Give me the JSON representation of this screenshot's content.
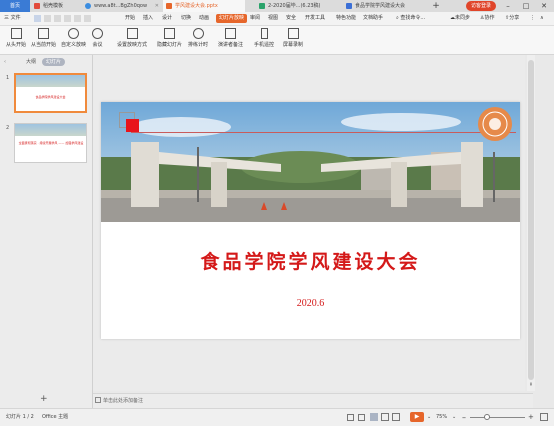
{
  "tabs": [
    {
      "label": "首页"
    },
    {
      "label": "稻壳模板"
    },
    {
      "label": "www.a8t...BgZh0qow"
    },
    {
      "label": "学风建设大会.pptx"
    },
    {
      "label": "2-2020届毕...(6.23稿)"
    },
    {
      "label": "食品学院学风建设大会"
    }
  ],
  "login_label": "访客登录",
  "menu": {
    "file": "三 文件",
    "items": [
      "开始",
      "插入",
      "设计",
      "切换",
      "动画",
      "幻灯片放映",
      "审阅",
      "视图",
      "安全",
      "开发工具",
      "特色功能",
      "文档助手"
    ],
    "search": "查找命令...",
    "unsynced": "未同步",
    "collab": "协作",
    "share": "分享"
  },
  "ribbon": {
    "buttons": [
      "从头开始",
      "从当前开始",
      "自定义放映",
      "会议",
      "设置放映方式",
      "隐藏幻灯片",
      "排练计时",
      "演讲者备注",
      "手机遥控",
      "屏幕录制"
    ]
  },
  "left_panel": {
    "tab_outline": "大纲",
    "tab_slides": "幻灯片",
    "thumbnails": [
      {
        "num": "1",
        "title": "食品学院学风建设大会"
      },
      {
        "num": "2",
        "title": "全面贯彻落实 · 持续开展学风 —— 加强学风建设"
      }
    ],
    "add_label": "+"
  },
  "slide": {
    "title": "食品学院学风建设大会",
    "date": "2020.6"
  },
  "notes_placeholder": "单击此处添加备注",
  "status": {
    "slide_info": "幻灯片 1 / 2",
    "theme": "Office 主题",
    "zoom": "75%"
  },
  "colors": {
    "accent": "#e6662b",
    "title_red": "#d41919",
    "home_tab": "#3a7bd5"
  }
}
